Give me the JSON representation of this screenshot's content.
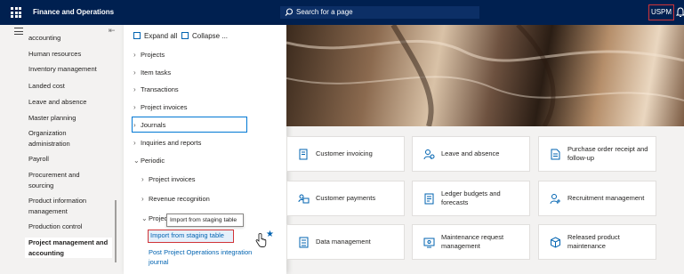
{
  "topbar": {
    "app_title": "Finance and Operations",
    "search_placeholder": "Search for a page",
    "company": "USPM",
    "colors": {
      "bar": "#002050",
      "highlight": "#d13438"
    }
  },
  "leftnav": {
    "items": [
      "accounting",
      "Human resources",
      "Inventory management",
      "Landed cost",
      "Leave and absence",
      "Master planning",
      "Organization administration",
      "Payroll",
      "Procurement and sourcing",
      "Product information management",
      "Production control",
      "Project management and accounting"
    ]
  },
  "flyout": {
    "expand_all": "Expand all",
    "collapse": "Collapse ...",
    "tree": [
      "Projects",
      "Item tasks",
      "Transactions",
      "Project invoices",
      "Journals",
      "Inquiries and reports",
      "Periodic",
      "Project invoices",
      "Revenue recognition",
      "Projec"
    ],
    "tooltip": "Import from staging table",
    "selected_link": "Import from staging table",
    "next_link": "Post Project Operations integration journal"
  },
  "tiles": [
    {
      "label": "Customer invoicing",
      "icon": "invoice-icon"
    },
    {
      "label": "Leave and absence",
      "icon": "person-icon"
    },
    {
      "label": "Purchase order receipt and follow-up",
      "icon": "document-icon"
    },
    {
      "label": "Customer payments",
      "icon": "people-icon"
    },
    {
      "label": "Ledger budgets and forecasts",
      "icon": "ledger-icon"
    },
    {
      "label": "Recruitment management",
      "icon": "recruit-icon"
    },
    {
      "label": "Data management",
      "icon": "data-icon"
    },
    {
      "label": "Maintenance request management",
      "icon": "maintenance-icon"
    },
    {
      "label": "Released product maintenance",
      "icon": "cube-icon"
    }
  ]
}
